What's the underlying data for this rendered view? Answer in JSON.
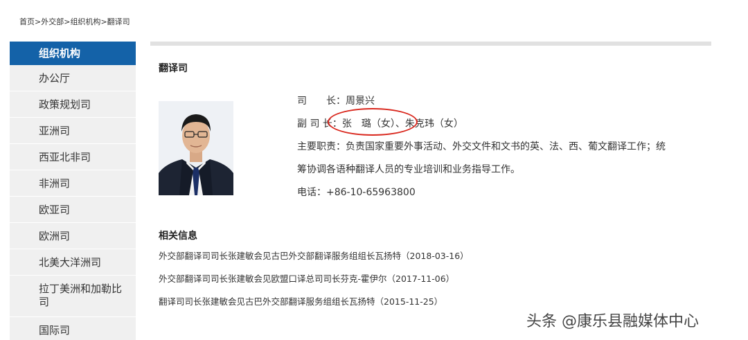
{
  "breadcrumb": {
    "items": [
      "首页",
      "外交部",
      "组织机构",
      "翻译司"
    ],
    "separator": ">"
  },
  "sidebar": {
    "header": "组织机构",
    "items": [
      {
        "label": "办公厅"
      },
      {
        "label": "政策规划司"
      },
      {
        "label": "亚洲司"
      },
      {
        "label": "西亚北非司"
      },
      {
        "label": "非洲司"
      },
      {
        "label": "欧亚司"
      },
      {
        "label": "欧洲司"
      },
      {
        "label": "北美大洋洲司"
      },
      {
        "label": "拉丁美洲和加勒比司"
      },
      {
        "label": "国际司"
      }
    ]
  },
  "main": {
    "dept_title": "翻译司",
    "info": {
      "director": "司　　长：周景兴",
      "deputy": "副 司 长：张　璐（女）、朱克玮（女）",
      "duty_1": "主要职责：负责国家重要外事活动、外交文件和文书的英、法、西、葡文翻译工作；统",
      "duty_2": "筹协调各语种翻译人员的专业培训和业务指导工作。",
      "phone": "电话：+86-10-65963800"
    },
    "related_title": "相关信息",
    "related": [
      {
        "text": "外交部翻译司司长张建敏会见古巴外交部翻译服务组组长瓦扬特（2018-03-16）"
      },
      {
        "text": "外交部翻译司司长张建敏会见欧盟口译总司司长芬克-霍伊尔（2017-11-06）"
      },
      {
        "text": "翻译司司长张建敏会见古巴外交部翻译服务组组长瓦扬特（2015-11-25）"
      }
    ]
  },
  "watermark": "头条 @康乐县融媒体中心",
  "colors": {
    "sidebar_header": "#1462a8",
    "sidebar_item": "#f0f0f0",
    "highlight_circle": "#d9261c"
  }
}
